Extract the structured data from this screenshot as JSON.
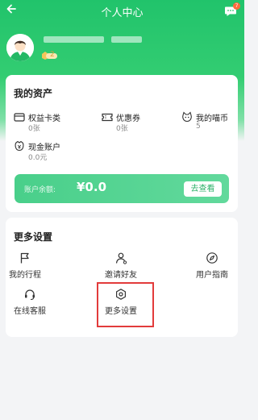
{
  "header": {
    "title": "个人中心",
    "message_badge": "7",
    "level_badge": "2",
    "colors": {
      "brand": "#21c36b",
      "accent": "#2db26a",
      "highlight": "#e23b3b"
    }
  },
  "assets": {
    "title": "我的资产",
    "items": [
      {
        "label": "权益卡类",
        "value": "0张",
        "icon": "card-icon"
      },
      {
        "label": "优惠券",
        "value": "0张",
        "icon": "ticket-icon"
      },
      {
        "label": "我的喵币",
        "value": "5",
        "icon": "cat-coin-icon"
      },
      {
        "label": "现金账户",
        "value": "0.0元",
        "icon": "wallet-icon"
      }
    ],
    "balance": {
      "label": "账户余额:",
      "value": "¥0.0",
      "button": "去查看"
    }
  },
  "settings": {
    "title": "更多设置",
    "items": [
      {
        "label": "我的行程",
        "icon": "flag-icon"
      },
      {
        "label": "邀请好友",
        "icon": "invite-icon"
      },
      {
        "label": "用户指南",
        "icon": "compass-icon"
      },
      {
        "label": "在线客服",
        "icon": "headset-icon"
      },
      {
        "label": "更多设置",
        "icon": "settings-icon"
      }
    ]
  }
}
